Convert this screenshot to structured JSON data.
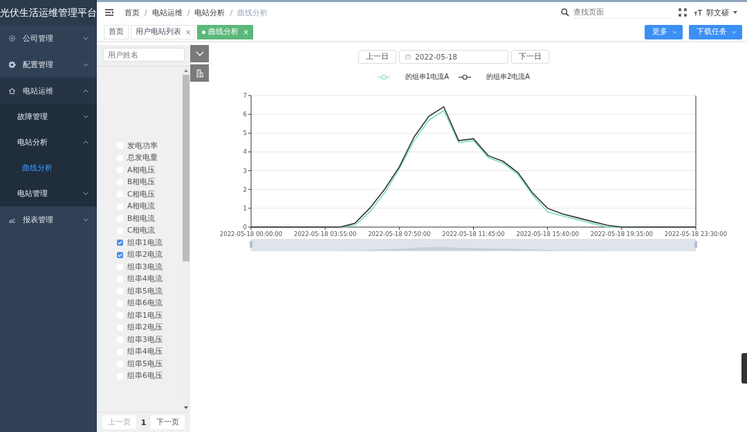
{
  "sidebar": {
    "title": "光伏生活运维管理平台",
    "items": [
      {
        "label": "公司管理",
        "expanded": false
      },
      {
        "label": "配置管理",
        "expanded": false
      },
      {
        "label": "电站运维",
        "expanded": true,
        "children": [
          {
            "label": "故障管理",
            "expanded": false
          },
          {
            "label": "电站分析",
            "expanded": true,
            "children": [
              {
                "label": "曲线分析",
                "selected": true
              }
            ]
          },
          {
            "label": "电站管理",
            "expanded": false
          }
        ]
      },
      {
        "label": "报表管理",
        "expanded": false
      }
    ]
  },
  "header": {
    "breadcrumb": [
      {
        "label": "首页",
        "current": false
      },
      {
        "label": "电站运维",
        "current": false
      },
      {
        "label": "电站分析",
        "current": false
      },
      {
        "label": "曲线分析",
        "current": true
      }
    ],
    "separator": "/",
    "search": {
      "placeholder": "查找页面"
    },
    "user": "郭文硕"
  },
  "tags": [
    {
      "label": "首页",
      "selected": false
    },
    {
      "label": "用户电站列表",
      "selected": false,
      "close": "×"
    },
    {
      "label": "曲线分析",
      "selected": true,
      "close": "×"
    }
  ],
  "actions": [
    "更多",
    "下载任务"
  ],
  "left_panel": {
    "search": {
      "placeholder": "用户姓名"
    },
    "checkboxes": [
      {
        "label": "发电功率",
        "checked": false
      },
      {
        "label": "总发电量",
        "checked": false
      },
      {
        "label": "A相电压",
        "checked": false
      },
      {
        "label": "B相电压",
        "checked": false
      },
      {
        "label": "C相电压",
        "checked": false
      },
      {
        "label": "A相电流",
        "checked": false
      },
      {
        "label": "B相电流",
        "checked": false
      },
      {
        "label": "C相电流",
        "checked": false
      },
      {
        "label": "组串1电流",
        "checked": true
      },
      {
        "label": "组串2电流",
        "checked": true
      },
      {
        "label": "组串3电流",
        "checked": false
      },
      {
        "label": "组串4电流",
        "checked": false
      },
      {
        "label": "组串5电流",
        "checked": false
      },
      {
        "label": "组串6电流",
        "checked": false
      },
      {
        "label": "组串1电压",
        "checked": false
      },
      {
        "label": "组串2电压",
        "checked": false
      },
      {
        "label": "组串3电压",
        "checked": false
      },
      {
        "label": "组串4电压",
        "checked": false
      },
      {
        "label": "组串5电压",
        "checked": false
      },
      {
        "label": "组串6电压",
        "checked": false
      }
    ],
    "pagination": {
      "prev": "上一页",
      "page": "1",
      "next": "下一页"
    }
  },
  "date_bar": {
    "prev": "上一日",
    "date": "2022-05-18",
    "next": "下一日"
  },
  "chart_data": {
    "type": "line",
    "categories": [
      "2022-05-18 00:00:00",
      null,
      null,
      null,
      null,
      "2022-05-18 03:55:00",
      null,
      null,
      null,
      null,
      "2022-05-18 07:50:00",
      null,
      null,
      null,
      null,
      "2022-05-18 11:45:00",
      null,
      null,
      null,
      null,
      "2022-05-18 15:40:00",
      null,
      null,
      null,
      null,
      "2022-05-18 19:35:00",
      null,
      null,
      null,
      null,
      "2022-05-18 23:30:00"
    ],
    "series": [
      {
        "name": "的组串1电流A",
        "color": "#7fdcc4",
        "values": [
          null,
          null,
          null,
          null,
          null,
          0,
          0,
          0.1,
          0.8,
          1.8,
          3.1,
          4.6,
          5.7,
          6.2,
          4.5,
          4.6,
          3.7,
          3.4,
          2.8,
          1.7,
          0.8,
          0.6,
          0.4,
          0.2,
          0,
          0,
          0,
          null,
          null,
          null,
          null
        ]
      },
      {
        "name": "的组串2电流A",
        "color": "#333333",
        "values": [
          0,
          0,
          0,
          0,
          0,
          0,
          0,
          0.2,
          1.0,
          2.0,
          3.2,
          4.8,
          5.9,
          6.4,
          4.6,
          4.7,
          3.8,
          3.5,
          2.9,
          1.8,
          1.0,
          0.7,
          0.5,
          0.3,
          0.1,
          0,
          0,
          0,
          0,
          0,
          0
        ]
      }
    ],
    "ylim": [
      0,
      7
    ],
    "grid": true,
    "yticks": [
      0,
      1,
      2,
      3,
      4,
      5,
      6,
      7
    ]
  }
}
